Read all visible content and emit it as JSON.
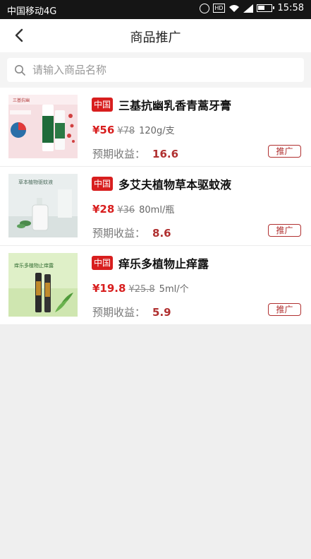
{
  "status_bar": {
    "carrier": "中国移动4G",
    "hd_badge": "HD",
    "time": "15:58",
    "icons": [
      "alarm-icon",
      "hd-icon",
      "wifi-icon",
      "signal-icon",
      "battery-icon"
    ]
  },
  "header": {
    "title": "商品推广",
    "back_icon": "chevron-left-icon"
  },
  "search": {
    "placeholder": "请输入商品名称",
    "icon": "search-icon"
  },
  "colors": {
    "accent": "#d81e1e",
    "earn": "#b03030",
    "background": "#efefef"
  },
  "products": [
    {
      "origin": "中国",
      "name": "三基抗幽乳香青蒿牙膏",
      "price": "¥56",
      "original_price": "¥78",
      "spec": "120g/支",
      "earn_label": "预期收益：",
      "earn_value": "16.6",
      "action": "推广",
      "thumb_text": "三基抗幽"
    },
    {
      "origin": "中国",
      "name": "多艾夫植物草本驱蚊液",
      "price": "¥28",
      "original_price": "¥36",
      "spec": "80ml/瓶",
      "earn_label": "预期收益：",
      "earn_value": "8.6",
      "action": "推广",
      "thumb_text": "草本植物驱蚊液"
    },
    {
      "origin": "中国",
      "name": "痒乐多植物止痒露",
      "price": "¥19.8",
      "original_price": "¥25.8",
      "spec": "5ml/个",
      "earn_label": "预期收益：",
      "earn_value": "5.9",
      "action": "推广",
      "thumb_text": "痒乐多植物止痒露"
    }
  ]
}
